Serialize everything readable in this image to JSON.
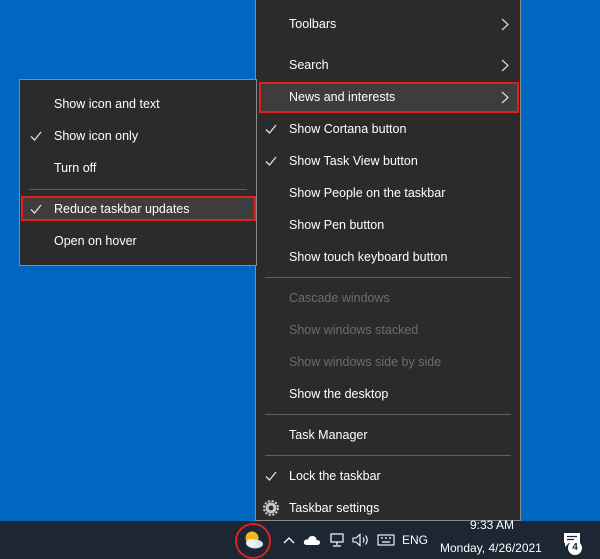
{
  "main_menu": {
    "items": [
      {
        "label": "Toolbars"
      },
      {
        "label": "Search"
      },
      {
        "label": "News and interests"
      },
      {
        "label": "Show Cortana button"
      },
      {
        "label": "Show Task View button"
      },
      {
        "label": "Show People on the taskbar"
      },
      {
        "label": "Show Pen button"
      },
      {
        "label": "Show touch keyboard button"
      },
      {
        "label": "Cascade windows"
      },
      {
        "label": "Show windows stacked"
      },
      {
        "label": "Show windows side by side"
      },
      {
        "label": "Show the desktop"
      },
      {
        "label": "Task Manager"
      },
      {
        "label": "Lock the taskbar"
      },
      {
        "label": "Taskbar settings"
      }
    ]
  },
  "sub_menu": {
    "items": [
      {
        "label": "Show icon and text"
      },
      {
        "label": "Show icon only"
      },
      {
        "label": "Turn off"
      },
      {
        "label": "Reduce taskbar updates"
      },
      {
        "label": "Open on hover"
      }
    ]
  },
  "taskbar": {
    "language": "ENG",
    "time": "9:33 AM",
    "date": "Monday, 4/26/2021",
    "notification_count": "4"
  },
  "colors": {
    "desktop": "#0067c0",
    "menu_bg": "#2b2b2b",
    "highlight_border": "#e02020",
    "taskbar": "#1c2733"
  },
  "icons": [
    "chevron-right-icon",
    "check-icon",
    "gear-icon",
    "weather-icon",
    "chevron-up-icon",
    "cloud-icon",
    "network-icon",
    "volume-icon",
    "keyboard-icon",
    "notification-icon"
  ]
}
